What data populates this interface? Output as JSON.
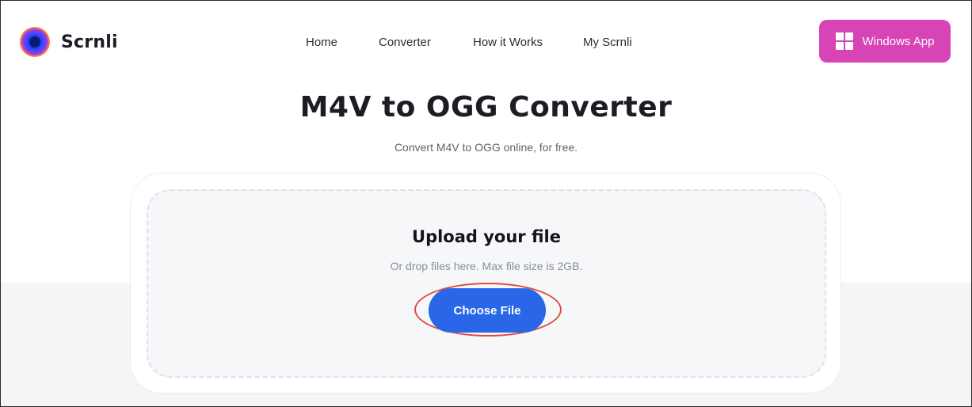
{
  "header": {
    "brand": "Scrnli",
    "nav": [
      {
        "label": "Home"
      },
      {
        "label": "Converter"
      },
      {
        "label": "How it Works"
      },
      {
        "label": "My Scrnli"
      }
    ],
    "cta_label": "Windows App",
    "cta_icon": "windows-icon",
    "cta_color": "#d744b5"
  },
  "hero": {
    "title": "M4V to OGG Converter",
    "subtitle": "Convert M4V to OGG online, for free."
  },
  "upload": {
    "title": "Upload your file",
    "hint": "Or drop files here. Max file size is 2GB.",
    "button_label": "Choose File",
    "button_color": "#2966e8",
    "highlight_color": "#e04a3f"
  }
}
